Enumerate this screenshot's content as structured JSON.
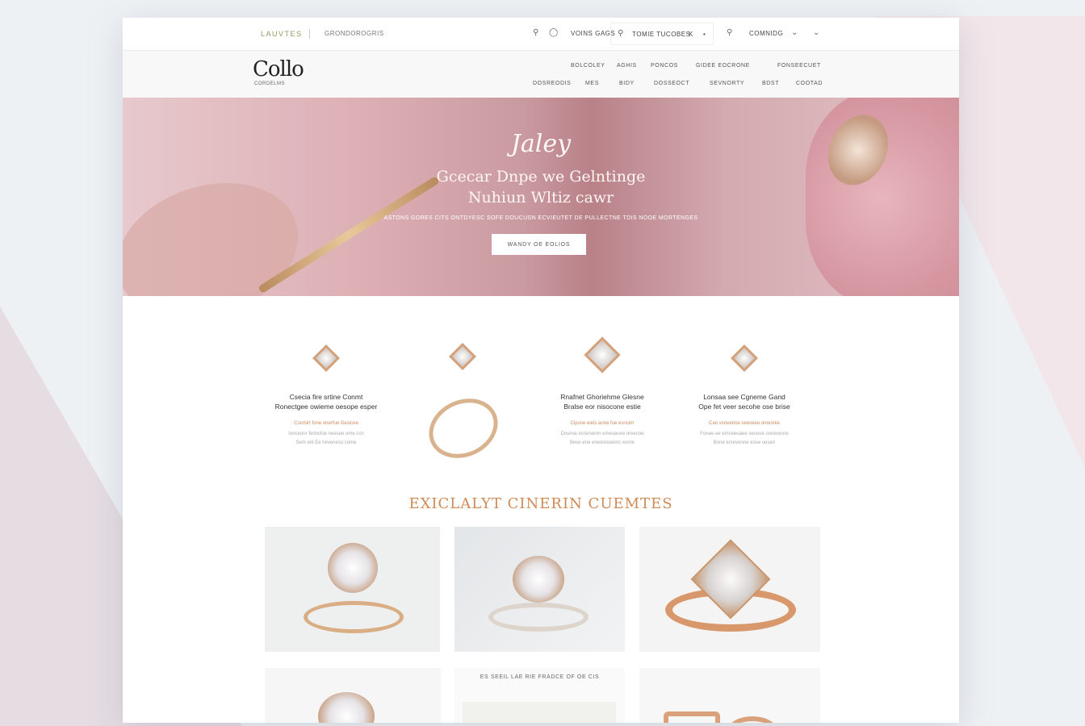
{
  "topbar": {
    "brand": "LAUVTES",
    "tagline": "GRONDOROGRIS",
    "search_label": "VOINS GAGS",
    "search_placeholder": "TOMIE TUCOBES",
    "search_extra": "K",
    "dot": "•",
    "account_label": "COMNIDG",
    "icons": [
      "search-icon",
      "user-icon",
      "search-icon",
      "chevron-down-icon",
      "chevron-down-icon"
    ]
  },
  "nav": {
    "logo": "Collo",
    "logo_sub": "CORDELMS",
    "row1": [
      "BOLCOLEY",
      "AGHIS",
      "PONCOS",
      "GIDEE EOCRONE",
      "FONSEECUET"
    ],
    "row2": [
      "DOSREODIS",
      "MES",
      "BIDY",
      "DOSSEOCT",
      "SEVNORTY",
      "BDST",
      "COOTAD"
    ]
  },
  "hero": {
    "script": "Jaley",
    "line1": "Gcecar Dnpe we Gelntinge",
    "line2": "Nuhiun Wltiz cawr",
    "sub": "ASTONS GORES CITS ONTDYESC SOFE DOUCUSN ECVIEUTET DE PULLECTNE TDIS NOOE MORTENGES",
    "cta": "WANDY OE EOLIOS"
  },
  "features": [
    {
      "title1": "Csecia fire srtine Conmt",
      "title2": "Ronectgee owieme oesope esper",
      "d1": "Cocmirt fone onerfue Gesicee",
      "d2a": "Ionceonr ferlocloe neesee ome ccn",
      "d2b": "Sem enl Ee neveneso come"
    },
    {
      "title1": "Rnafnet Ghoriehme Glesne",
      "title2": "Bralse eor nisocone estie",
      "d1": "Cipsne eiels aone fue esncirn",
      "d2a": "Dosnse ecrienemn emeseoee oreecoe",
      "d2b": "Beve ene eneoreseemc esore"
    },
    {
      "title1": "Lonsaa see Cgneme Gand",
      "title2": "Ope fet veer secohe ose brise",
      "d1": "Can vsneenoe seeseee omeonie",
      "d2a": "Fonee ee emceeuaee seceoe oonerecne",
      "d2b": "Bone ecrevenne ecee oesen"
    }
  ],
  "section_title": "EXICLALYT CINERIN CUEMTES",
  "bottom_caption": "ES SEEIL LAE RIE FRADCE OF OE CIS",
  "colors": {
    "accent": "#d08a55",
    "rose": "#dcaeb3",
    "gold": "#d9b38e"
  }
}
